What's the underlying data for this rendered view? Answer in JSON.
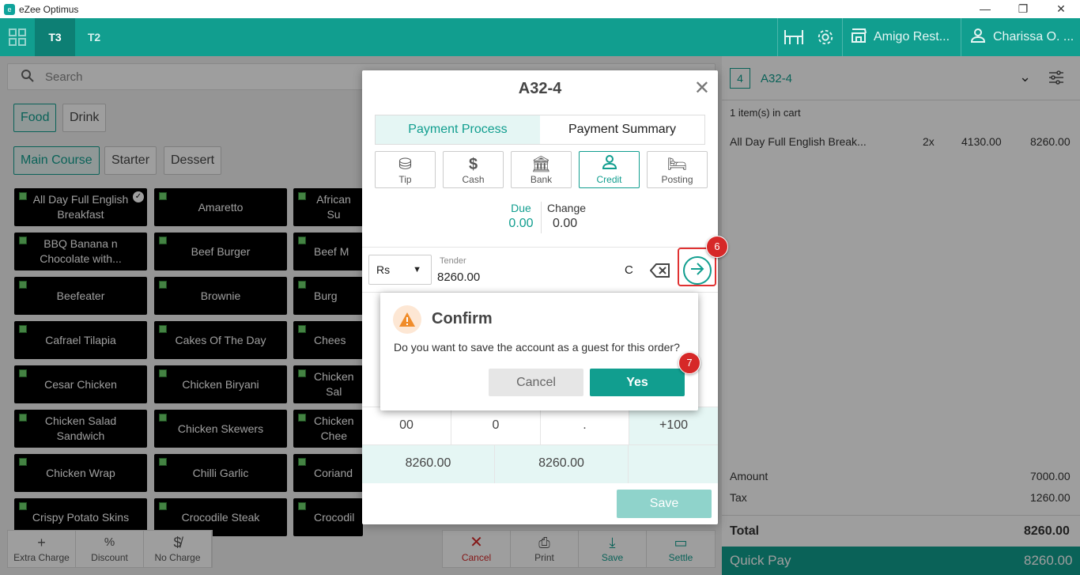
{
  "window": {
    "app_title": "eZee Optimus",
    "minimize": "—",
    "restore": "❐",
    "close": "✕"
  },
  "topbar": {
    "tabs": [
      "T3",
      "T2"
    ],
    "outlet": "Amigo Rest...",
    "user": "Charissa O. ..."
  },
  "search": {
    "placeholder": "Search"
  },
  "categories": [
    "Food",
    "Drink"
  ],
  "subcategories": [
    "Main Course",
    "Starter",
    "Dessert"
  ],
  "items": [
    [
      "All Day Full English Breakfast",
      "Amaretto",
      "African Su"
    ],
    [
      "BBQ Banana n Chocolate with...",
      "Beef Burger",
      "Beef M"
    ],
    [
      "Beefeater",
      "Brownie",
      "Burg"
    ],
    [
      "Cafrael Tilapia",
      "Cakes Of The Day",
      "Chees"
    ],
    [
      "Cesar Chicken",
      "Chicken Biryani",
      "Chicken Sal"
    ],
    [
      "Chicken Salad Sandwich",
      "Chicken Skewers",
      "Chicken Chee"
    ],
    [
      "Chicken Wrap",
      "Chilli Garlic",
      "Coriand"
    ],
    [
      "Crispy Potato Skins",
      "Crocodile Steak",
      "Crocodil"
    ]
  ],
  "bottom_actions_left": [
    "Extra Charge",
    "Discount",
    "No Charge"
  ],
  "bottom_actions_right": [
    "Cancel",
    "Print",
    "Save",
    "Settle"
  ],
  "cart": {
    "count": "4",
    "table": "A32-4",
    "items_info": "1 item(s) in cart",
    "line": {
      "name": "All Day Full English Break...",
      "qty": "2x",
      "price": "4130.00",
      "total": "8260.00"
    },
    "amount_label": "Amount",
    "amount": "7000.00",
    "tax_label": "Tax",
    "tax": "1260.00",
    "total_label": "Total",
    "total": "8260.00",
    "quick_pay_label": "Quick Pay",
    "quick_pay": "8260.00"
  },
  "payment_modal": {
    "title": "A32-4",
    "tabs": [
      "Payment Process",
      "Payment Summary"
    ],
    "methods": [
      "Tip",
      "Cash",
      "Bank",
      "Credit",
      "Posting"
    ],
    "due_label": "Due",
    "due": "0.00",
    "change_label": "Change",
    "change": "0.00",
    "currency": "Rs",
    "tender_label": "Tender",
    "tender_value": "8260.00",
    "clear": "C",
    "keypad_row": [
      "00",
      "0",
      ".",
      "+100"
    ],
    "amount_row": [
      "8260.00",
      "8260.00"
    ],
    "save_label": "Save"
  },
  "confirm": {
    "title": "Confirm",
    "message": "Do you want to save the account as a guest for this order?",
    "cancel": "Cancel",
    "yes": "Yes"
  },
  "steps": [
    "6",
    "7"
  ],
  "colors": {
    "accent": "#119e8f",
    "danger": "#d62828"
  }
}
